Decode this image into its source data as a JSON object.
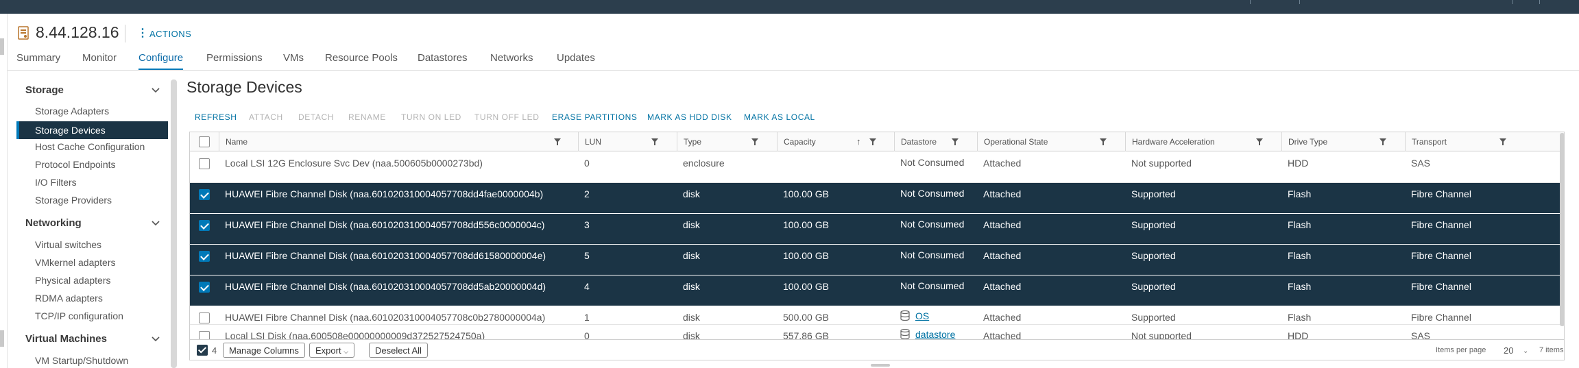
{
  "header": {
    "host_name": "8.44.128.16",
    "actions_label": "ACTIONS"
  },
  "tabs": [
    {
      "label": "Summary"
    },
    {
      "label": "Monitor"
    },
    {
      "label": "Configure"
    },
    {
      "label": "Permissions"
    },
    {
      "label": "VMs"
    },
    {
      "label": "Resource Pools"
    },
    {
      "label": "Datastores"
    },
    {
      "label": "Networks"
    },
    {
      "label": "Updates"
    }
  ],
  "active_tab": "Configure",
  "sidebar": {
    "groups": [
      {
        "label": "Storage",
        "items": [
          "Storage Adapters",
          "Storage Devices",
          "Host Cache Configuration",
          "Protocol Endpoints",
          "I/O Filters",
          "Storage Providers"
        ]
      },
      {
        "label": "Networking",
        "items": [
          "Virtual switches",
          "VMkernel adapters",
          "Physical adapters",
          "RDMA adapters",
          "TCP/IP configuration"
        ]
      },
      {
        "label": "Virtual Machines",
        "items": [
          "VM Startup/Shutdown"
        ]
      }
    ],
    "selected": "Storage Devices"
  },
  "page_title": "Storage Devices",
  "toolbar": {
    "buttons": [
      {
        "label": "REFRESH",
        "enabled": true
      },
      {
        "label": "ATTACH",
        "enabled": false
      },
      {
        "label": "DETACH",
        "enabled": false
      },
      {
        "label": "RENAME",
        "enabled": false
      },
      {
        "label": "TURN ON LED",
        "enabled": false
      },
      {
        "label": "TURN OFF LED",
        "enabled": false
      },
      {
        "label": "ERASE PARTITIONS",
        "enabled": true
      },
      {
        "label": "MARK AS HDD DISK",
        "enabled": true
      },
      {
        "label": "MARK AS LOCAL",
        "enabled": true
      }
    ]
  },
  "grid": {
    "columns": [
      "Name",
      "LUN",
      "Type",
      "Capacity",
      "Datastore",
      "Operational State",
      "Hardware Acceleration",
      "Drive Type",
      "Transport"
    ],
    "rows": [
      {
        "selected": false,
        "name": "Local LSI 12G Enclosure Svc Dev (naa.500605b0000273bd)",
        "lun": "0",
        "type": "enclosure",
        "capacity": "",
        "datastore": "Not Consumed",
        "datastore_link": false,
        "state": "Attached",
        "hw_accel": "Not supported",
        "drive": "HDD",
        "transport": "SAS"
      },
      {
        "selected": true,
        "name": "HUAWEI Fibre Channel Disk (naa.601020310004057708dd4fae0000004b)",
        "lun": "2",
        "type": "disk",
        "capacity": "100.00 GB",
        "datastore": "Not Consumed",
        "datastore_link": false,
        "state": "Attached",
        "hw_accel": "Supported",
        "drive": "Flash",
        "transport": "Fibre Channel"
      },
      {
        "selected": true,
        "name": "HUAWEI Fibre Channel Disk (naa.601020310004057708dd556c0000004c)",
        "lun": "3",
        "type": "disk",
        "capacity": "100.00 GB",
        "datastore": "Not Consumed",
        "datastore_link": false,
        "state": "Attached",
        "hw_accel": "Supported",
        "drive": "Flash",
        "transport": "Fibre Channel"
      },
      {
        "selected": true,
        "name": "HUAWEI Fibre Channel Disk (naa.601020310004057708dd61580000004e)",
        "lun": "5",
        "type": "disk",
        "capacity": "100.00 GB",
        "datastore": "Not Consumed",
        "datastore_link": false,
        "state": "Attached",
        "hw_accel": "Supported",
        "drive": "Flash",
        "transport": "Fibre Channel"
      },
      {
        "selected": true,
        "name": "HUAWEI Fibre Channel Disk (naa.601020310004057708dd5ab20000004d)",
        "lun": "4",
        "type": "disk",
        "capacity": "100.00 GB",
        "datastore": "Not Consumed",
        "datastore_link": false,
        "state": "Attached",
        "hw_accel": "Supported",
        "drive": "Flash",
        "transport": "Fibre Channel"
      },
      {
        "selected": false,
        "name": "HUAWEI Fibre Channel Disk (naa.601020310004057708c0b2780000004a)",
        "lun": "1",
        "type": "disk",
        "capacity": "500.00 GB",
        "datastore": "OS",
        "datastore_link": true,
        "state": "Attached",
        "hw_accel": "Supported",
        "drive": "Flash",
        "transport": "Fibre Channel"
      },
      {
        "selected": false,
        "name": "Local LSI Disk (naa.600508e00000000009d372527524750a)",
        "lun": "0",
        "type": "disk",
        "capacity": "557.86 GB",
        "datastore": "datastore",
        "datastore_link": true,
        "state": "Attached",
        "hw_accel": "Not supported",
        "drive": "HDD",
        "transport": "SAS"
      }
    ]
  },
  "footer": {
    "selected_count": "4",
    "manage_columns": "Manage Columns",
    "export": "Export",
    "deselect_all": "Deselect All",
    "items_per_page_label": "Items per page",
    "items_per_page": "20",
    "total_items": "7 items"
  },
  "colors": {
    "accent": "#0079b8",
    "selected_row": "#1b3445",
    "topbar": "#2c3e4d"
  }
}
